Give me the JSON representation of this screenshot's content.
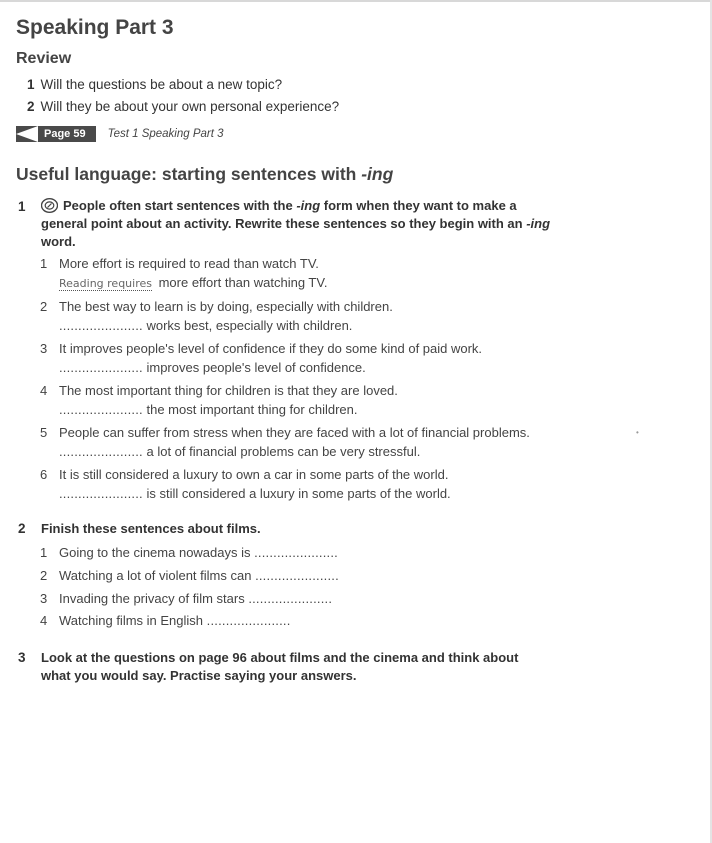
{
  "title": "Speaking Part 3",
  "review": {
    "heading": "Review",
    "items": [
      {
        "num": "1",
        "text": "Will the questions be about a new topic?"
      },
      {
        "num": "2",
        "text": "Will they be about your own personal experience?"
      }
    ]
  },
  "page_ref": {
    "tab_label": "Page 59",
    "text": "Test 1 Speaking Part 3"
  },
  "useful": {
    "heading_main": "Useful language: starting sentences with ",
    "heading_em": "-ing"
  },
  "task1": {
    "num": "1",
    "line1_a": "People often start sentences with the ",
    "line1_em": "-ing",
    "line1_b": " form when they want to make a",
    "line2_a": "general point about an activity. Rewrite these sentences so they begin with an ",
    "line2_em": "-ing",
    "line3": "word.",
    "items": [
      {
        "num": "1",
        "text": "More effort is required to read than watch TV.",
        "answer_example": "Reading requires",
        "answer_rest": " more effort than watching TV."
      },
      {
        "num": "2",
        "text": "The best way to learn is by doing, especially with children.",
        "dots": "......................",
        "answer_rest": " works best, especially with children."
      },
      {
        "num": "3",
        "text": "It improves people's level of confidence if they do some kind of paid work.",
        "dots": "......................",
        "answer_rest": " improves people's level of confidence."
      },
      {
        "num": "4",
        "text": "The most important thing for children is that they are loved.",
        "dots": "......................",
        "answer_rest": " the most important thing for children."
      },
      {
        "num": "5",
        "text": "People can suffer from stress when they are faced with a lot of financial problems.",
        "dots": "......................",
        "answer_rest": " a lot of financial problems can be very stressful."
      },
      {
        "num": "6",
        "text": "It is still considered a luxury to own a car in some parts of the world.",
        "dots": "......................",
        "answer_rest": " is still considered a luxury in some parts of the world."
      }
    ]
  },
  "task2": {
    "num": "2",
    "text": "Finish these sentences about films.",
    "items": [
      {
        "num": "1",
        "text": "Going to the cinema nowadays is ",
        "dots": "......................"
      },
      {
        "num": "2",
        "text": "Watching a lot of violent films can ",
        "dots": "......................"
      },
      {
        "num": "3",
        "text": "Invading the privacy of film stars ",
        "dots": "......................"
      },
      {
        "num": "4",
        "text": "Watching films in English ",
        "dots": "......................"
      }
    ]
  },
  "task3": {
    "num": "3",
    "line1": "Look at the questions on page 96 about films and the cinema and think about",
    "line2": "what you would say. Practise saying your answers."
  },
  "icons": {
    "audio": "audio-cd-icon",
    "back": "back-arrow-icon"
  },
  "colors": {
    "text": "#333333",
    "tab_bg": "#4a4a4a",
    "heading": "#444444"
  }
}
